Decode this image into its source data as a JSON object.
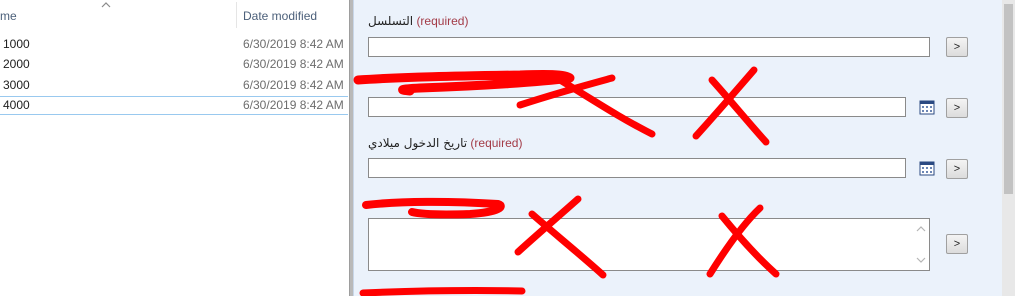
{
  "explorer": {
    "columns": {
      "name": "me",
      "date": "Date modified"
    },
    "rows": [
      {
        "name": "1000",
        "date": "6/30/2019 8:42 AM"
      },
      {
        "name": "2000",
        "date": "6/30/2019 8:42 AM"
      },
      {
        "name": "3000",
        "date": "6/30/2019 8:42 AM"
      },
      {
        "name": "4000",
        "date": "6/30/2019 8:42 AM"
      }
    ]
  },
  "form": {
    "field1": {
      "label_ar": "التسلسل",
      "required": "(required)",
      "button": ">"
    },
    "field2": {
      "button": ">"
    },
    "field3": {
      "label_ar": "تاريخ الدخول ميلادي",
      "required": "(required)",
      "button": ">"
    },
    "field4": {
      "button": ">"
    }
  },
  "colors": {
    "required": "#a33b47",
    "scribble": "#ff0000",
    "form_bg": "#ebf2fb"
  }
}
